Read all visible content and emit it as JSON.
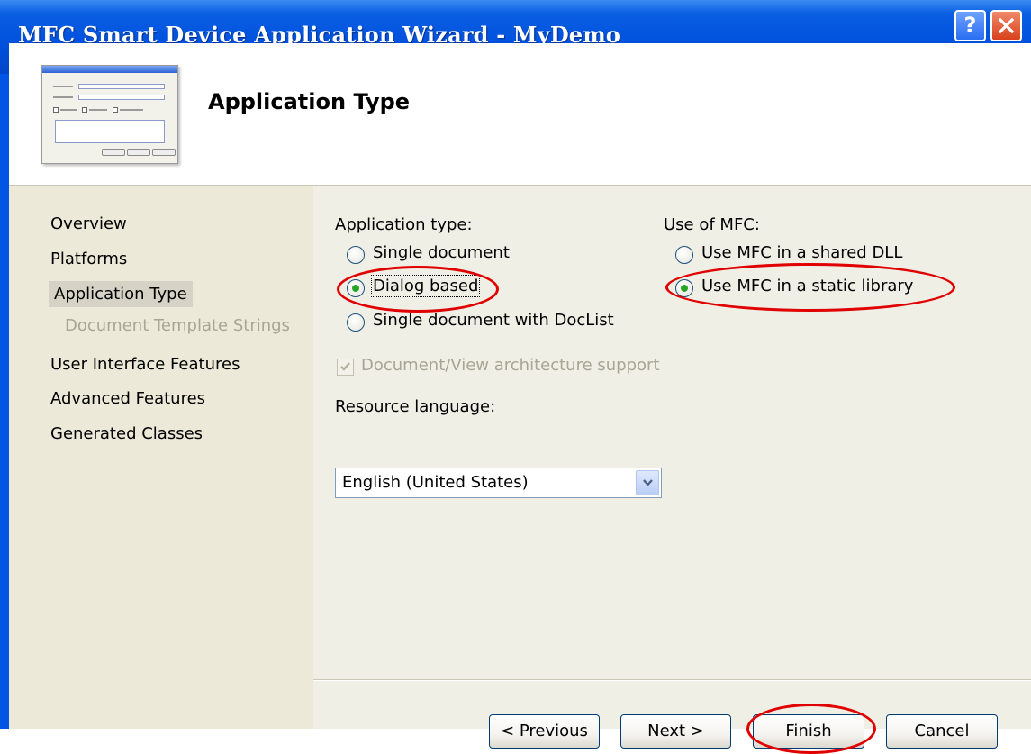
{
  "window": {
    "title": "MFC Smart Device Application Wizard - MyDemo",
    "help_glyph": "?",
    "close_icon": "close-icon"
  },
  "header": {
    "page_title": "Application Type",
    "thumbnail_icon": "dialog-preview-icon"
  },
  "sidebar": {
    "items": [
      {
        "label": "Overview",
        "state": "normal"
      },
      {
        "label": "Platforms",
        "state": "normal"
      },
      {
        "label": "Application Type",
        "state": "selected"
      },
      {
        "label": "Document Template Strings",
        "state": "disabled"
      },
      {
        "label": "User Interface Features",
        "state": "normal"
      },
      {
        "label": "Advanced Features",
        "state": "normal"
      },
      {
        "label": "Generated Classes",
        "state": "normal"
      }
    ]
  },
  "main": {
    "app_type": {
      "heading": "Application type:",
      "options": [
        {
          "label": "Single document",
          "selected": false
        },
        {
          "label": "Dialog based",
          "selected": true
        },
        {
          "label": "Single document with DocList",
          "selected": false
        }
      ]
    },
    "mfc_use": {
      "heading": "Use of MFC:",
      "options": [
        {
          "label": "Use MFC in a shared DLL",
          "selected": false
        },
        {
          "label": "Use MFC in a static library",
          "selected": true
        }
      ]
    },
    "docview": {
      "label": "Document/View architecture support",
      "checked": true,
      "enabled": false
    },
    "resource_language": {
      "label": "Resource language:",
      "value": "English (United States)"
    }
  },
  "buttons": {
    "previous": "< Previous",
    "next": "Next >",
    "finish": "Finish",
    "cancel": "Cancel"
  },
  "colors": {
    "title_bar": "#0055e5",
    "dialog_bg": "#ece9d8",
    "annotation": "#e00000",
    "radio_dot": "#28a528"
  }
}
